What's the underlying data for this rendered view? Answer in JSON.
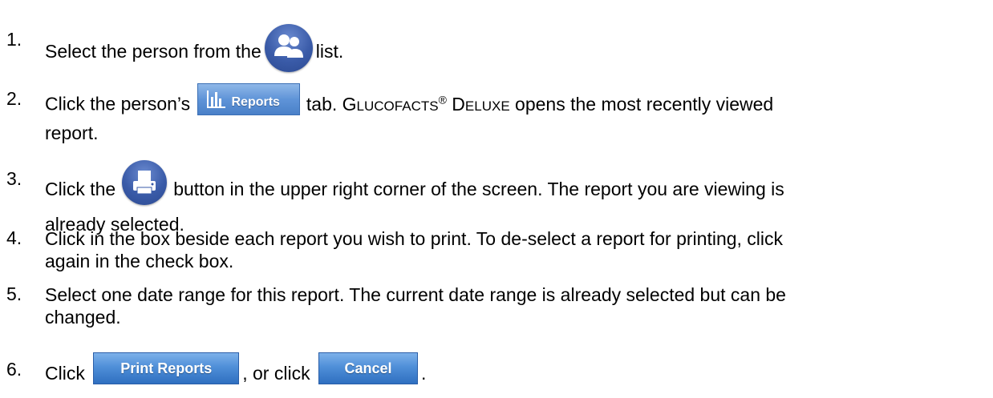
{
  "steps": [
    {
      "number": "1.",
      "before": "Select the person from the",
      "icon": "people-icon",
      "after": "list."
    },
    {
      "number": "2.",
      "before": "Click the person’s",
      "tab_label": "Reports",
      "after_a": "tab. G",
      "after_b": "LUCOFACTS",
      "after_c": "®",
      "after_d": " D",
      "after_e": "ELUXE",
      "after_f": " opens the most recently viewed",
      "line2": "report."
    },
    {
      "number": "3.",
      "before": "Click the",
      "icon": "print-icon",
      "after": "button in the upper right corner of the screen. The report you are viewing is",
      "line2": "already selected."
    },
    {
      "number": "4.",
      "line1": "Click in the box beside each report you wish to print. To de-select a report for printing, click",
      "line2": "again in the check box."
    },
    {
      "number": "5.",
      "line1": "Select one date range for this report. The current date range is already selected but can be",
      "line2": "changed."
    },
    {
      "number": "6.",
      "before": "Click",
      "print_button_label": "Print Reports",
      "middle": ", or click",
      "cancel_button_label": "Cancel",
      "after": "."
    }
  ]
}
